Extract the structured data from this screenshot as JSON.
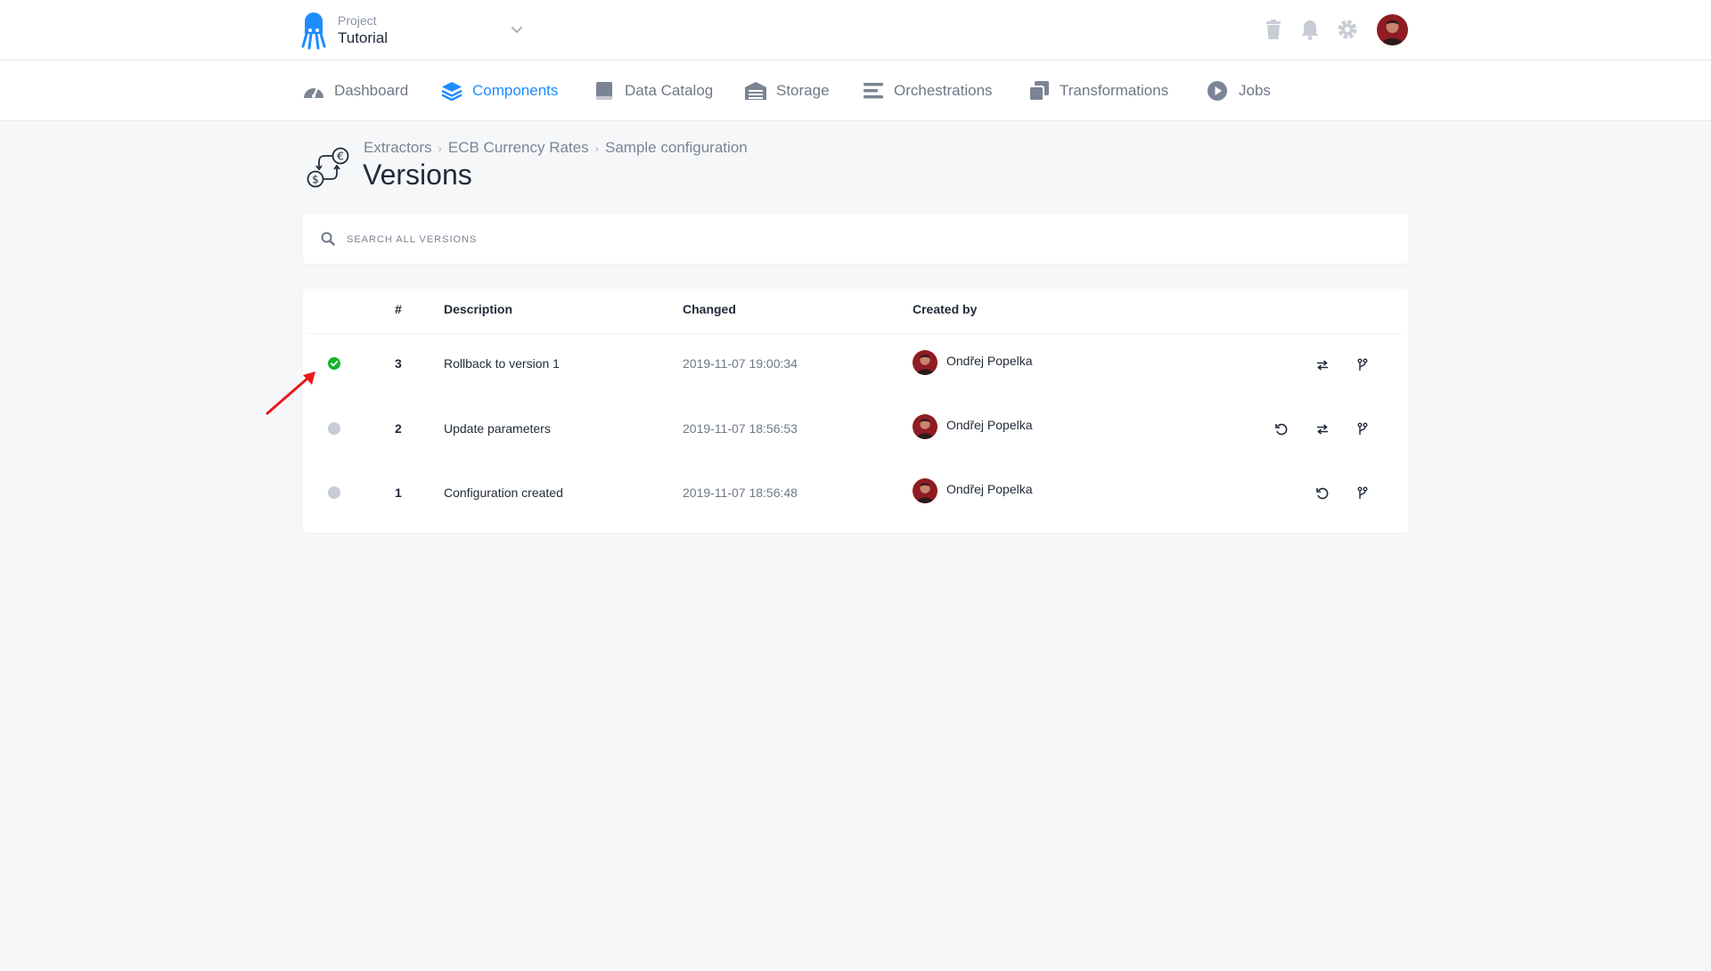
{
  "header": {
    "project_label": "Project",
    "project_name": "Tutorial",
    "icons": [
      "trash-icon",
      "bell-icon",
      "gear-icon"
    ]
  },
  "nav": {
    "items": [
      {
        "label": "Dashboard",
        "icon": "dashboard-icon",
        "active": false
      },
      {
        "label": "Components",
        "icon": "layers-icon",
        "active": true
      },
      {
        "label": "Data Catalog",
        "icon": "book-icon",
        "active": false
      },
      {
        "label": "Storage",
        "icon": "warehouse-icon",
        "active": false
      },
      {
        "label": "Orchestrations",
        "icon": "bars-icon",
        "active": false
      },
      {
        "label": "Transformations",
        "icon": "clone-icon",
        "active": false
      },
      {
        "label": "Jobs",
        "icon": "play-circle-icon",
        "active": false
      }
    ]
  },
  "breadcrumb": [
    "Extractors",
    "ECB Currency Rates",
    "Sample configuration"
  ],
  "page": {
    "title": "Versions"
  },
  "search": {
    "placeholder": "SEARCH ALL VERSIONS",
    "value": ""
  },
  "table": {
    "headers": [
      "#",
      "Description",
      "Changed",
      "Created by"
    ],
    "rows": [
      {
        "version": "3",
        "description": "Rollback to version 1",
        "changed": "2019-11-07 19:00:34",
        "created_by": "Ondřej Popelka",
        "current": true,
        "actions": [
          "compare-icon",
          "branch-icon"
        ]
      },
      {
        "version": "2",
        "description": "Update parameters",
        "changed": "2019-11-07 18:56:53",
        "created_by": "Ondřej Popelka",
        "current": false,
        "actions": [
          "rollback-icon",
          "compare-icon",
          "branch-icon"
        ]
      },
      {
        "version": "1",
        "description": "Configuration created",
        "changed": "2019-11-07 18:56:48",
        "created_by": "Ondřej Popelka",
        "current": false,
        "actions": [
          "rollback-icon",
          "branch-icon"
        ]
      }
    ]
  },
  "colors": {
    "accent": "#1e8cff",
    "success": "#15b32c",
    "inactive": "#c8ccd4",
    "annotation": "#e8191c"
  }
}
